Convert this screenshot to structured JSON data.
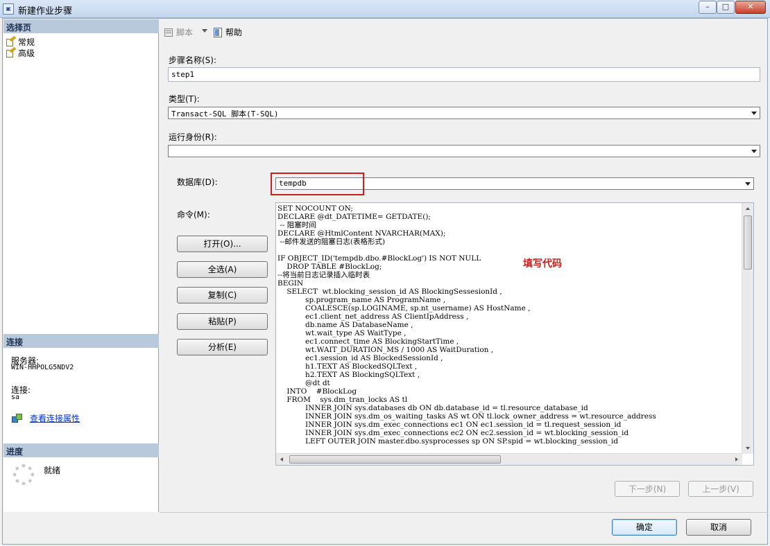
{
  "window": {
    "title": "新建作业步骤",
    "app_icon": "app-icon",
    "minimize": "–",
    "maximize": "□",
    "close": "✕"
  },
  "left": {
    "select_page_header": "选择页",
    "pages": [
      {
        "label": "常规",
        "icon": "page-icon"
      },
      {
        "label": "高级",
        "icon": "page-icon"
      }
    ],
    "connection_header": "连接",
    "server_label": "服务器:",
    "server_value": "WIN-HHPOLG5NDV2",
    "connection_label": "连接:",
    "connection_value": "sa",
    "view_props_link": "查看连接属性",
    "progress_header": "进度",
    "progress_status": "就绪"
  },
  "toolbar": {
    "script_label": "脚本",
    "help_label": "帮助"
  },
  "form": {
    "step_name_label": "步骤名称(S):",
    "step_name_value": "step1",
    "type_label": "类型(T):",
    "type_value": "Transact-SQL 脚本(T-SQL)",
    "run_as_label": "运行身份(R):",
    "run_as_value": "",
    "database_label": "数据库(D):",
    "database_value": "tempdb",
    "command_label": "命令(M):",
    "annotation": "填写代码",
    "code_lines": [
      "SET NOCOUNT ON;",
      "DECLARE @dt_DATETIME= GETDATE();",
      " -- 阻塞时间",
      "DECLARE @HtmlContent NVARCHAR(MAX);",
      " --邮件发送的阻塞日志(表格形式)",
      "",
      "IF OBJECT_ID('tempdb.dbo.#BlockLog') IS NOT NULL",
      "    DROP TABLE #BlockLog;",
      "--将当前日志记录插入临时表",
      "BEGIN",
      "    SELECT  wt.blocking_session_id AS BlockingSessesionId ,",
      "            sp.program_name AS ProgramName ,",
      "            COALESCE(sp.LOGINAME, sp.nt_username) AS HostName ,",
      "            ec1.client_net_address AS ClientIpAddress ,",
      "            db.name AS DatabaseName ,",
      "            wt.wait_type AS WaitType ,",
      "            ec1.connect_time AS BlockingStartTime ,",
      "            wt.WAIT_DURATION_MS / 1000 AS WaitDuration ,",
      "            ec1.session_id AS BlockedSessionId ,",
      "            h1.TEXT AS BlockedSQLText ,",
      "            h2.TEXT AS BlockingSQLText ,",
      "            @dt dt",
      "    INTO    #BlockLog",
      "    FROM    sys.dm_tran_locks AS tl",
      "            INNER JOIN sys.databases db ON db.database_id = tl.resource_database_id",
      "            INNER JOIN sys.dm_os_waiting_tasks AS wt ON tl.lock_owner_address = wt.resource_address",
      "            INNER JOIN sys.dm_exec_connections ec1 ON ec1.session_id = tl.request_session_id",
      "            INNER JOIN sys.dm_exec_connections ec2 ON ec2.session_id = wt.blocking_session_id",
      "            LEFT OUTER JOIN master.dbo.sysprocesses sp ON SP.spid = wt.blocking_session_id"
    ],
    "hscroll_grip": "III",
    "vscroll_grip": "≡"
  },
  "buttons": {
    "open": "打开(O)...",
    "select_all": "全选(A)",
    "copy": "复制(C)",
    "paste": "粘贴(P)",
    "parse": "分析(E)",
    "next": "下一步(N)",
    "prev": "上一步(V)",
    "ok": "确定",
    "cancel": "取消"
  },
  "colors": {
    "highlight_box": "#c8201c",
    "annotation": "#c8201c",
    "section_header_bg": "#b9c9dc",
    "link": "#0033cc"
  }
}
